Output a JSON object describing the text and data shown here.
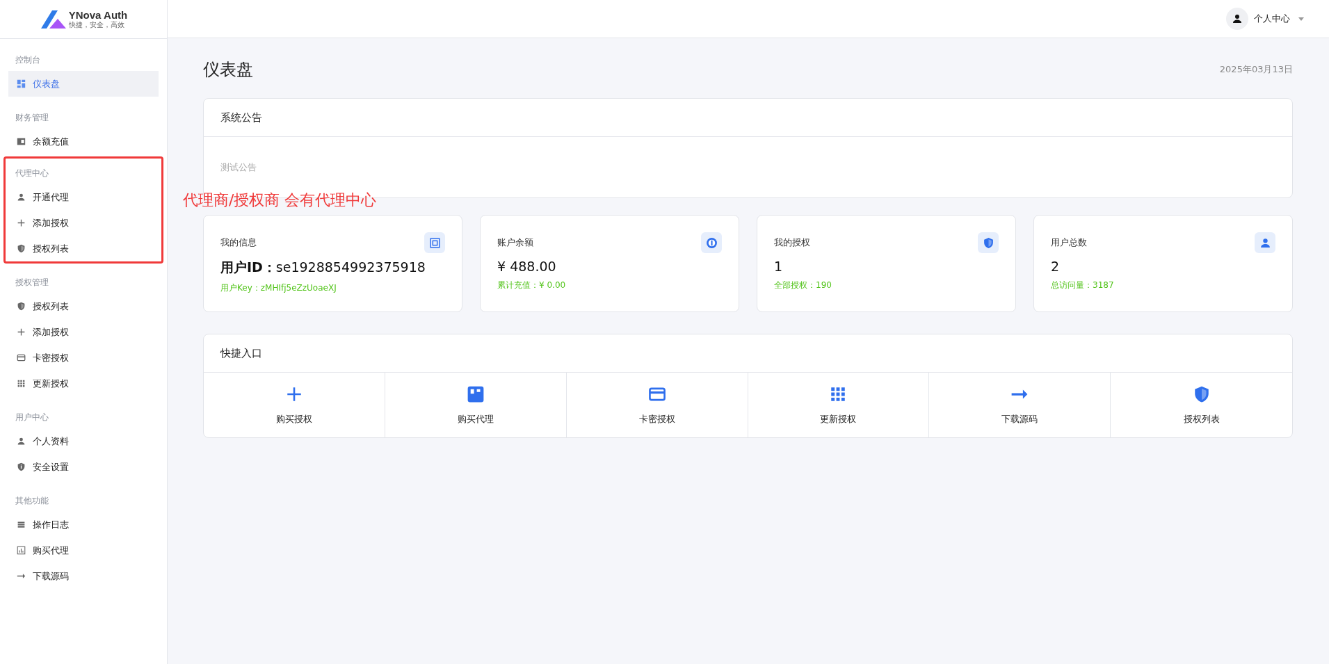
{
  "logo": {
    "name": "YNova Auth",
    "tagline": "快捷，安全，高效"
  },
  "header": {
    "user_menu": "个人中心"
  },
  "sidebar": {
    "groups": [
      {
        "label": "控制台",
        "highlighted": false,
        "items": [
          {
            "label": "仪表盘",
            "selected": true
          }
        ]
      },
      {
        "label": "财务管理",
        "highlighted": false,
        "items": [
          {
            "label": "余额充值",
            "selected": false
          }
        ]
      },
      {
        "label": "代理中心",
        "highlighted": true,
        "items": [
          {
            "label": "开通代理",
            "selected": false
          },
          {
            "label": "添加授权",
            "selected": false
          },
          {
            "label": "授权列表",
            "selected": false
          }
        ]
      },
      {
        "label": "授权管理",
        "highlighted": false,
        "items": [
          {
            "label": "授权列表",
            "selected": false
          },
          {
            "label": "添加授权",
            "selected": false
          },
          {
            "label": "卡密授权",
            "selected": false
          },
          {
            "label": "更新授权",
            "selected": false
          }
        ]
      },
      {
        "label": "用户中心",
        "highlighted": false,
        "items": [
          {
            "label": "个人资料",
            "selected": false
          },
          {
            "label": "安全设置",
            "selected": false
          }
        ]
      },
      {
        "label": "其他功能",
        "highlighted": false,
        "items": [
          {
            "label": "操作日志",
            "selected": false
          },
          {
            "label": "购买代理",
            "selected": false
          },
          {
            "label": "下载源码",
            "selected": false
          }
        ]
      }
    ]
  },
  "page": {
    "title": "仪表盘",
    "date": "2025年03月13日"
  },
  "announcement": {
    "title": "系统公告",
    "body": "测试公告"
  },
  "annotation": "代理商/授权商 会有代理中心",
  "stats": [
    {
      "label": "我的信息",
      "value": "**用户ID：**se1928854992375918",
      "sub": "用户Key：zMHIfj5eZzUoaeXJ"
    },
    {
      "label": "账户余额",
      "value": "¥ 488.00",
      "sub": "累计充值：¥ 0.00"
    },
    {
      "label": "我的授权",
      "value": "1",
      "sub": "全部授权：190"
    },
    {
      "label": "用户总数",
      "value": "2",
      "sub": "总访问量：3187"
    }
  ],
  "quick_entry": {
    "title": "快捷入口",
    "items": [
      "购买授权",
      "购买代理",
      "卡密授权",
      "更新授权",
      "下载源码",
      "授权列表"
    ]
  }
}
